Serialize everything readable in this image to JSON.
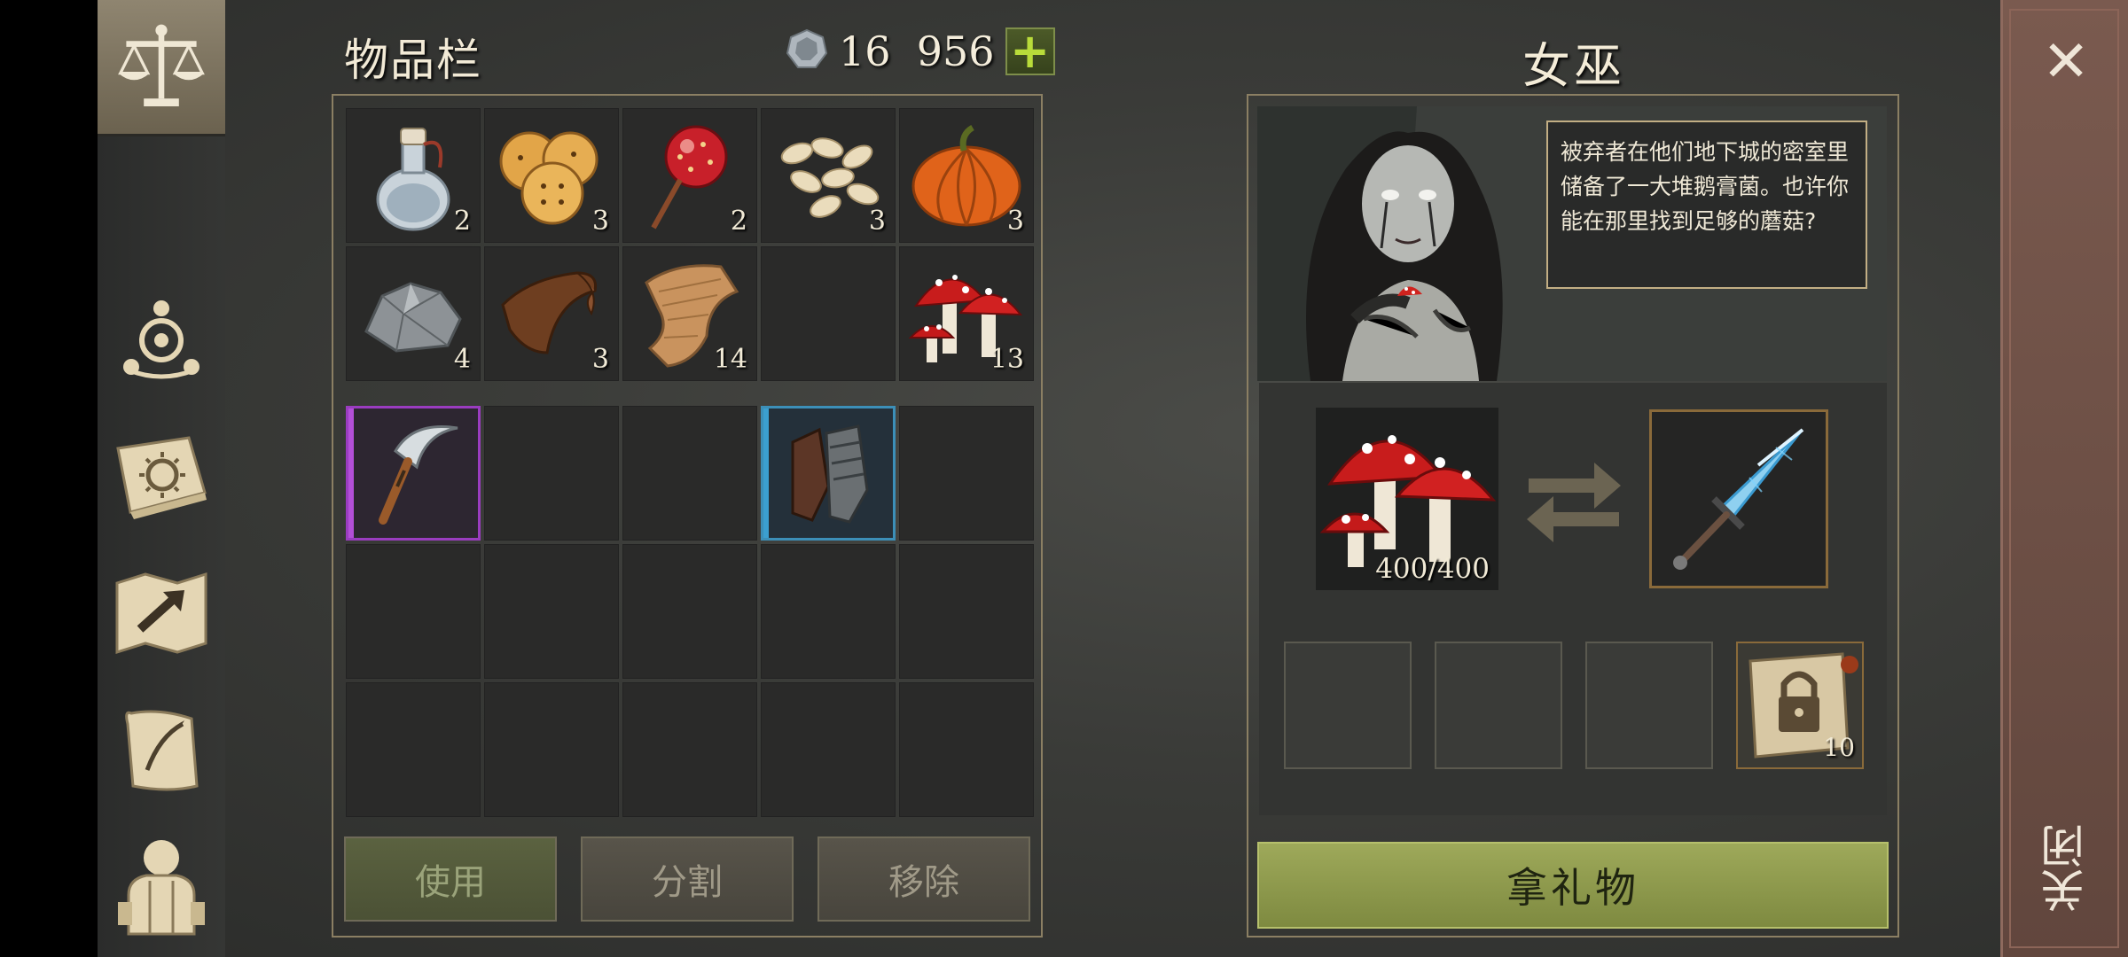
{
  "inventory": {
    "title": "物品栏",
    "currency_amount": "16  956",
    "add_currency_label": "+",
    "grid_top": [
      {
        "icon": "water-flask-icon",
        "count": "2"
      },
      {
        "icon": "crackers-icon",
        "count": "3"
      },
      {
        "icon": "candy-apple-icon",
        "count": "2"
      },
      {
        "icon": "pumpkin-seeds-icon",
        "count": "3"
      },
      {
        "icon": "pumpkin-icon",
        "count": "3"
      },
      {
        "icon": "stone-icon",
        "count": "4"
      },
      {
        "icon": "leather-icon",
        "count": "3"
      },
      {
        "icon": "cloth-icon",
        "count": "14"
      },
      {
        "icon": "empty",
        "count": ""
      },
      {
        "icon": "fly-agaric-mushroom-icon",
        "count": "13"
      }
    ],
    "equipment_items": [
      {
        "icon": "sickle-icon",
        "rarity": "purple"
      },
      {
        "icon": "gauntlets-icon",
        "rarity": "blue"
      }
    ],
    "buttons": {
      "use": "使用",
      "split": "分割",
      "remove": "移除"
    }
  },
  "witch": {
    "title": "女巫",
    "dialogue": "被弃者在他们地下城的密室里储备了一大堆鹅膏菌。也许你能在那里找到足够的蘑菇?",
    "required_item": {
      "icon": "fly-agaric-mushroom-icon",
      "progress": "400/400"
    },
    "reward_item": {
      "icon": "ice-sword-icon"
    },
    "extra_rewards": [
      {
        "icon": "empty"
      },
      {
        "icon": "empty"
      },
      {
        "icon": "empty"
      },
      {
        "icon": "locked-scroll-icon",
        "count": "10"
      }
    ],
    "gift_button": "拿礼物"
  },
  "close": {
    "label": "关闭",
    "x_symbol": "✕"
  },
  "colors": {
    "accent_green": "#9ea95a",
    "epic_purple": "#9a3cc0",
    "rare_blue": "#3c8fb8",
    "frame_gold": "#8b7f63"
  }
}
